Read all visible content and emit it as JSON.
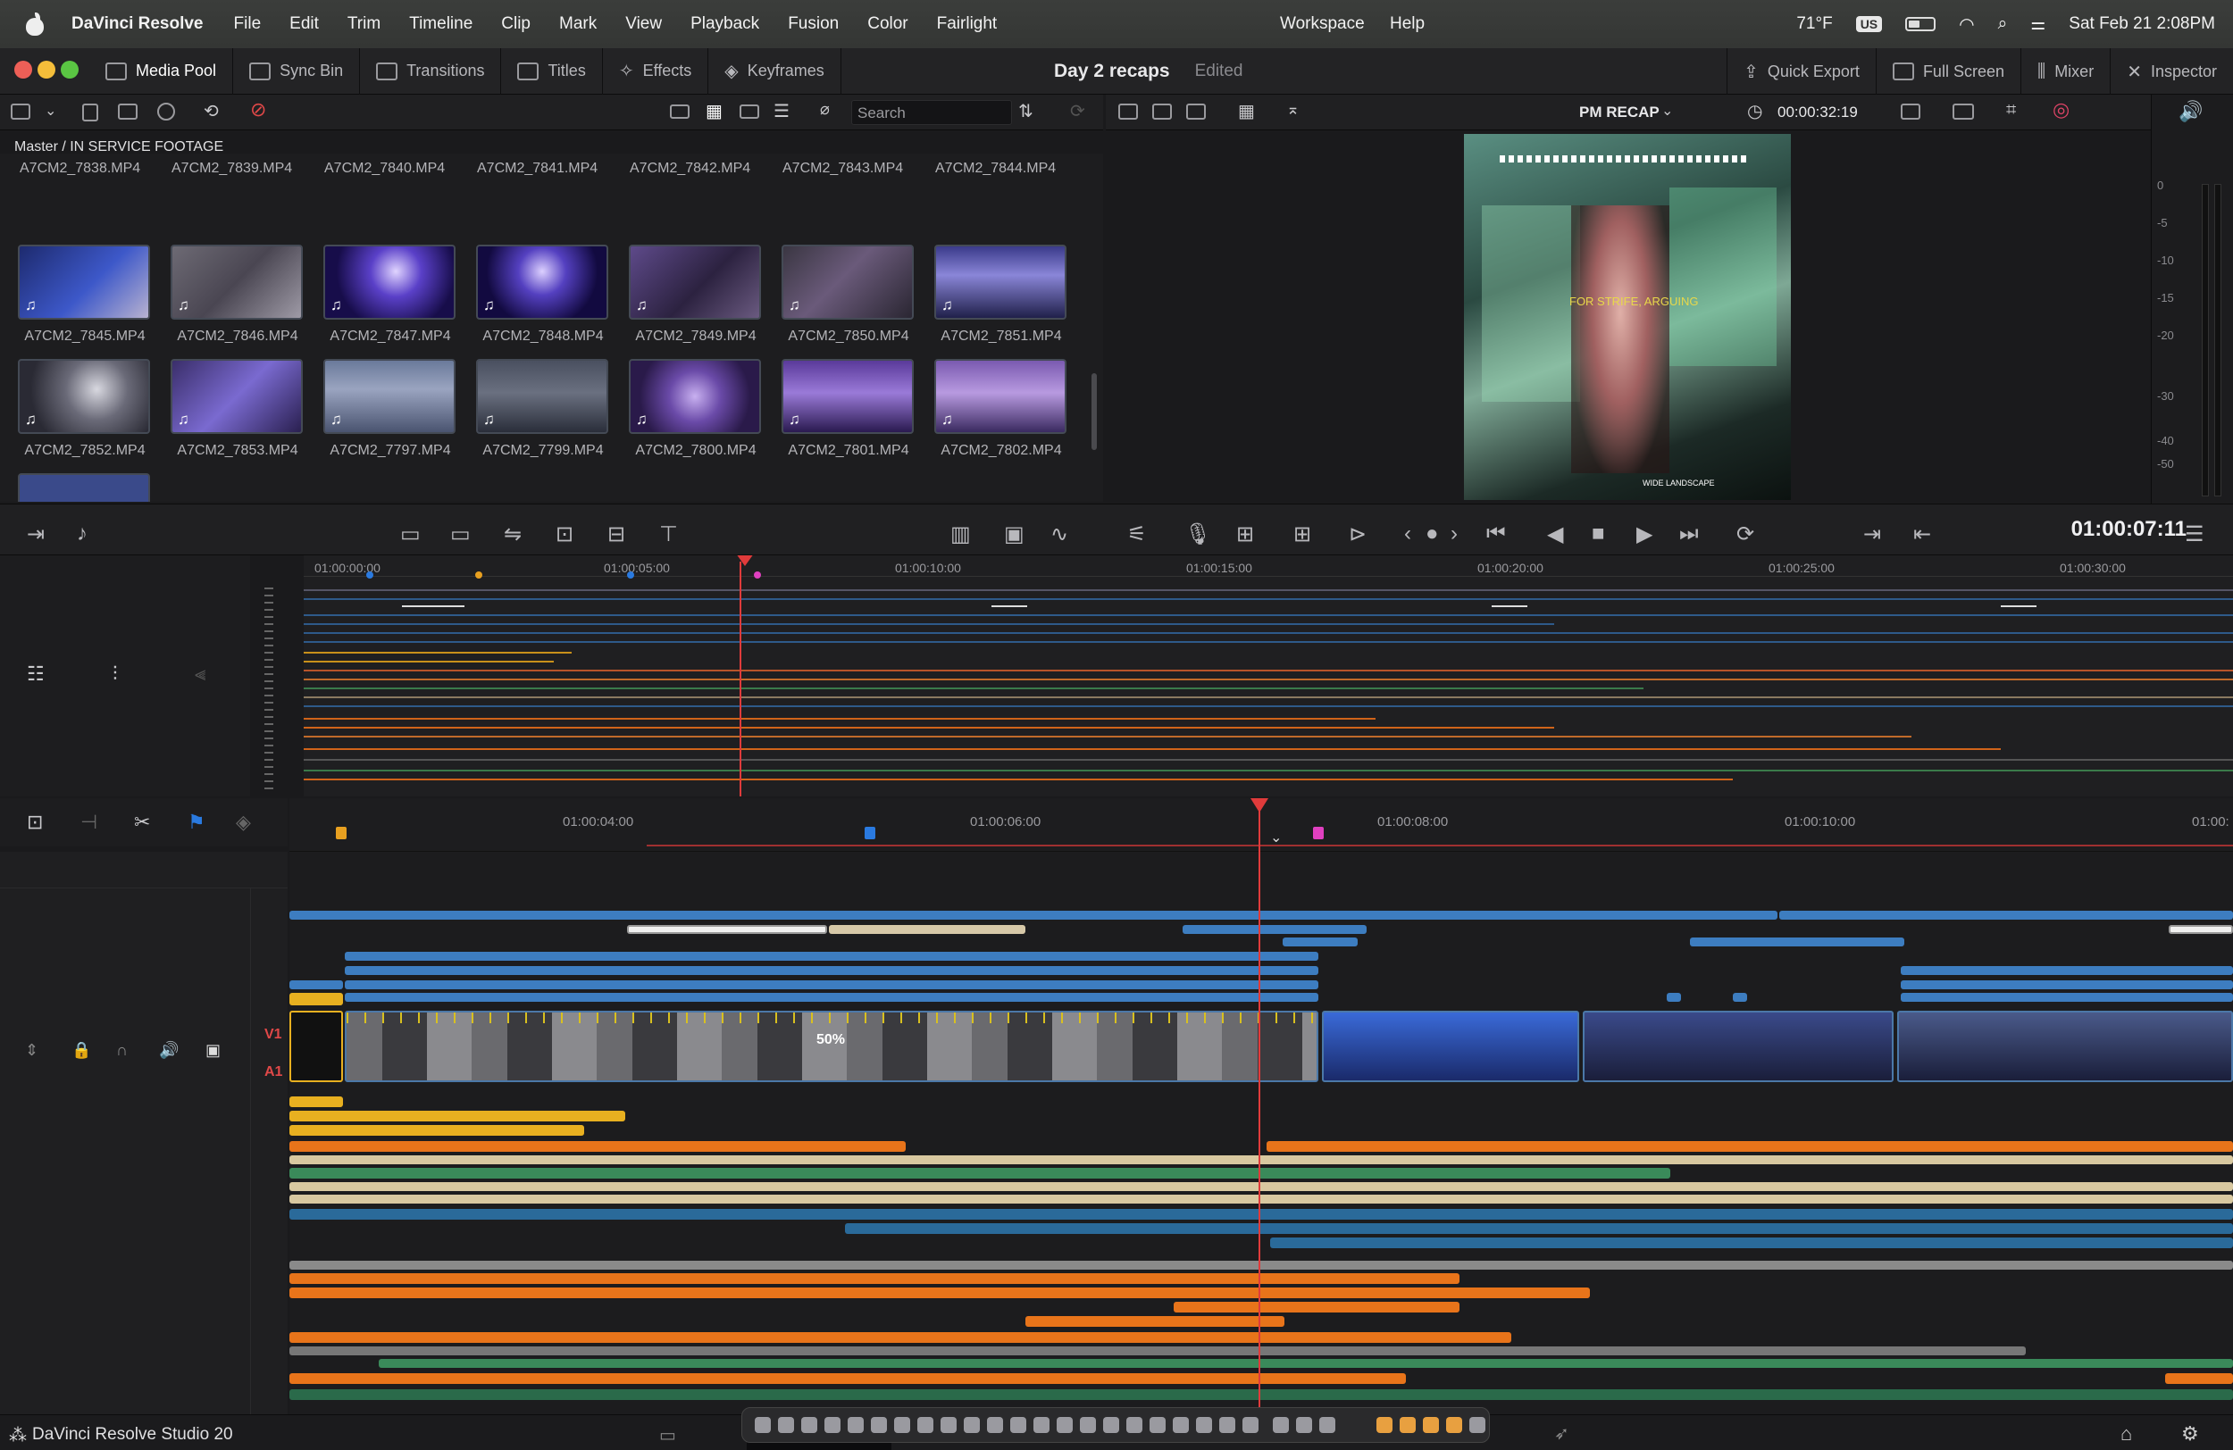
{
  "menubar": {
    "app": "DaVinci Resolve",
    "items": [
      "File",
      "Edit",
      "Trim",
      "Timeline",
      "Clip",
      "Mark",
      "View",
      "Playback",
      "Fusion",
      "Color",
      "Fairlight"
    ],
    "right_items": [
      "Workspace",
      "Help"
    ],
    "weather": "71°F",
    "input_source": "US",
    "datetime": "Sat Feb 21  2:08PM"
  },
  "toolbar": {
    "media_pool": "Media Pool",
    "sync_bin": "Sync Bin",
    "transitions": "Transitions",
    "titles": "Titles",
    "effects": "Effects",
    "keyframes": "Keyframes",
    "project_title": "Day 2 recaps",
    "project_status": "Edited",
    "quick_export": "Quick Export",
    "full_screen": "Full Screen",
    "mixer": "Mixer",
    "inspector": "Inspector"
  },
  "media_pool": {
    "search_placeholder": "Search",
    "path": "Master / IN SERVICE FOOTAGE",
    "top_row": [
      "A7CM2_7838.MP4",
      "A7CM2_7839.MP4",
      "A7CM2_7840.MP4",
      "A7CM2_7841.MP4",
      "A7CM2_7842.MP4",
      "A7CM2_7843.MP4",
      "A7CM2_7844.MP4"
    ],
    "row1": [
      "A7CM2_7845.MP4",
      "A7CM2_7846.MP4",
      "A7CM2_7847.MP4",
      "A7CM2_7848.MP4",
      "A7CM2_7849.MP4",
      "A7CM2_7850.MP4",
      "A7CM2_7851.MP4"
    ],
    "row2": [
      "A7CM2_7852.MP4",
      "A7CM2_7853.MP4",
      "A7CM2_7797.MP4",
      "A7CM2_7799.MP4",
      "A7CM2_7800.MP4",
      "A7CM2_7801.MP4",
      "A7CM2_7802.MP4"
    ]
  },
  "viewer": {
    "timeline_name": "PM RECAP",
    "duration": "00:00:32:19",
    "overlay_text": "FOR STRIFE, ARGUING",
    "lower_text": "WIDE LANDSCAPE",
    "timecode": "01:00:07:11"
  },
  "meters": {
    "ticks": [
      "0",
      "-5",
      "-10",
      "-15",
      "-20",
      "-30",
      "-40",
      "-50"
    ]
  },
  "upper_ruler": [
    "01:00:00:00",
    "01:00:05:00",
    "01:00:10:00",
    "01:00:15:00",
    "01:00:20:00",
    "01:00:25:00",
    "01:00:30:00"
  ],
  "lower_ruler": [
    "01:00:04:00",
    "01:00:06:00",
    "01:00:08:00",
    "01:00:10:00",
    "01:00:"
  ],
  "tracks": {
    "v1": "V1",
    "a1": "A1",
    "speed": "50%"
  },
  "bottom": {
    "brand": "DaVinci Resolve Studio 20"
  }
}
